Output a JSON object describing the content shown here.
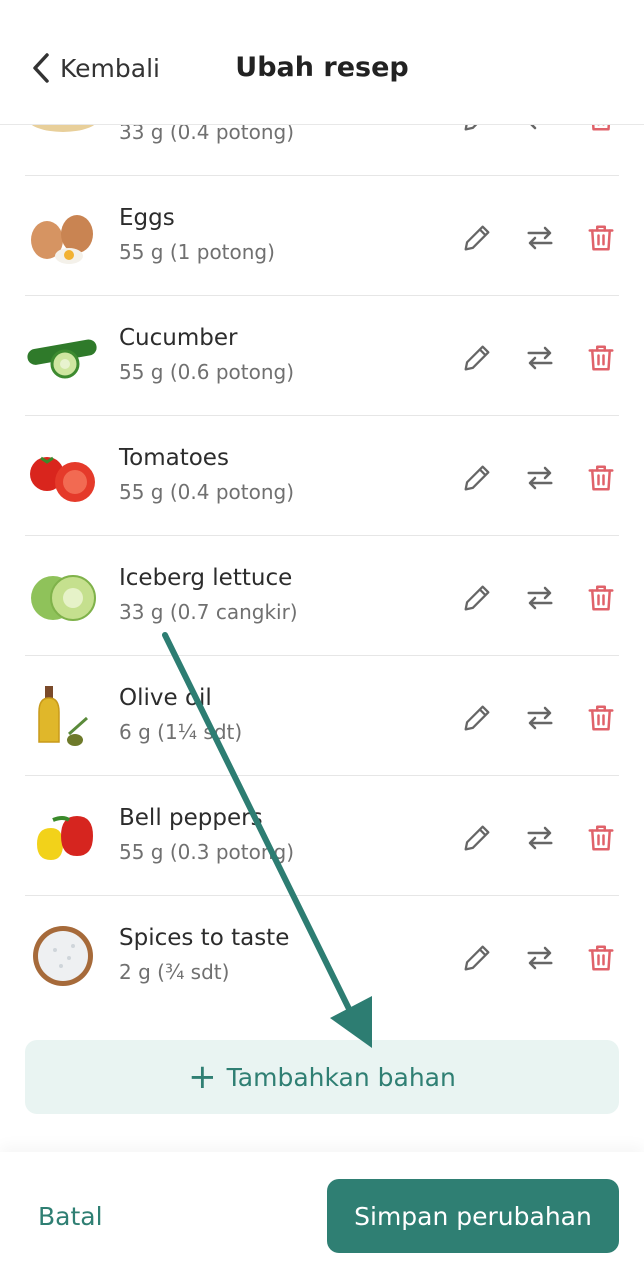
{
  "header": {
    "back_label": "Kembali",
    "title": "Ubah resep"
  },
  "ingredients": [
    {
      "name": "",
      "amount": "33 g (0.4 potong)",
      "icon": "tortilla-image"
    },
    {
      "name": "Eggs",
      "amount": "55 g (1 potong)",
      "icon": "eggs-image"
    },
    {
      "name": "Cucumber",
      "amount": "55 g (0.6 potong)",
      "icon": "cucumber-image"
    },
    {
      "name": "Tomatoes",
      "amount": "55 g (0.4 potong)",
      "icon": "tomatoes-image"
    },
    {
      "name": "Iceberg lettuce",
      "amount": "33 g (0.7 cangkir)",
      "icon": "lettuce-image"
    },
    {
      "name": "Olive oil",
      "amount": "6 g (1¼ sdt)",
      "icon": "olive-oil-image"
    },
    {
      "name": "Bell peppers",
      "amount": "55 g (0.3 potong)",
      "icon": "bell-peppers-image"
    },
    {
      "name": "Spices to taste",
      "amount": "2 g (¾ sdt)",
      "icon": "salt-image"
    }
  ],
  "add_button": {
    "plus": "+",
    "label": "Tambahkan bahan"
  },
  "footer": {
    "cancel_label": "Batal",
    "save_label": "Simpan perubahan"
  },
  "colors": {
    "accent": "#2f7f73",
    "delete": "#e0626a",
    "action_icon": "#666666",
    "add_bg": "#e9f4f2"
  }
}
